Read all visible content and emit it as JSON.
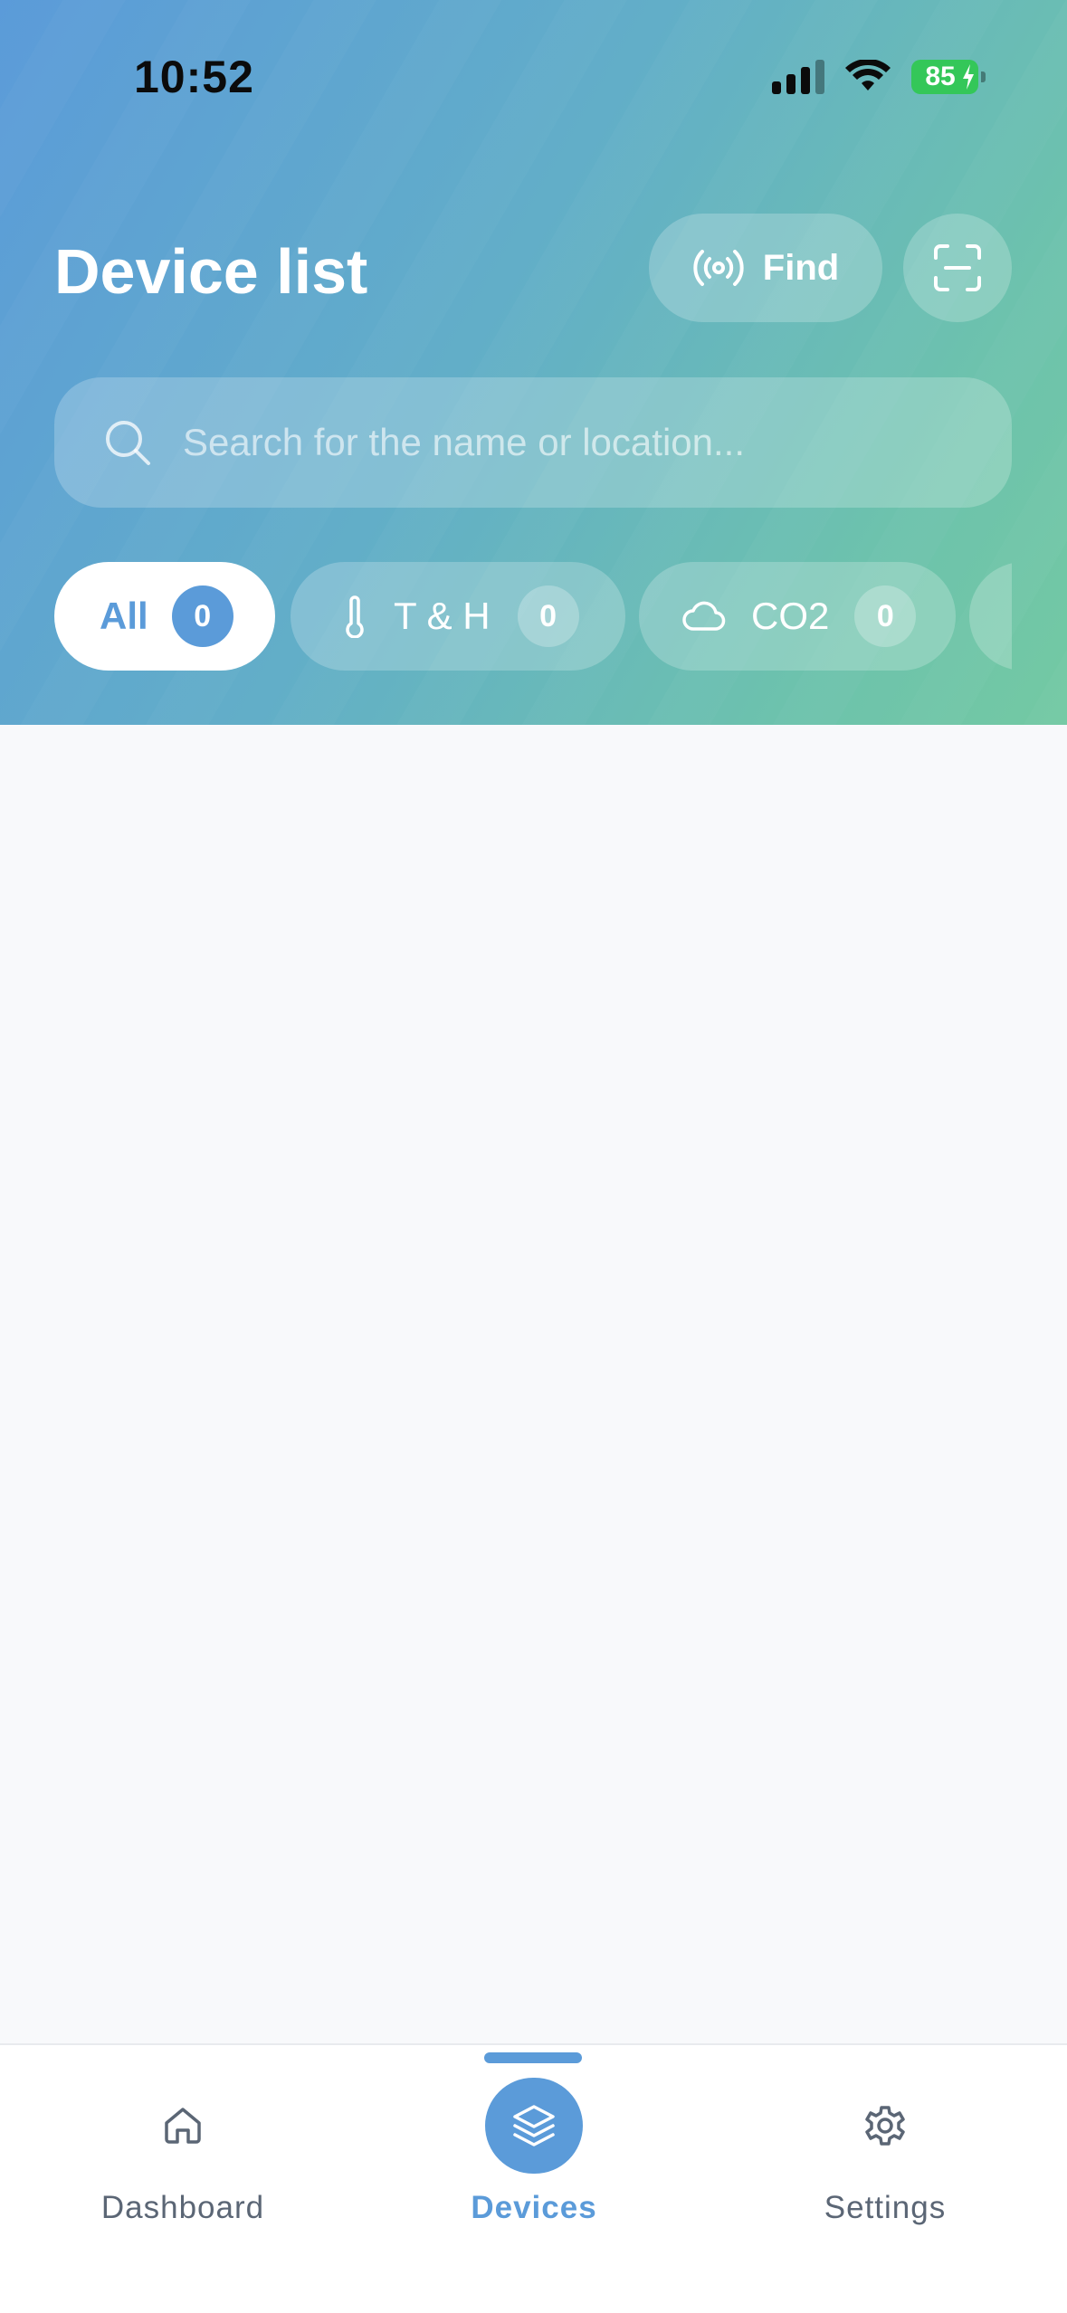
{
  "status_bar": {
    "time": "10:52",
    "battery": "85"
  },
  "header": {
    "title": "Device list",
    "find_label": "Find"
  },
  "search": {
    "placeholder": "Search for the name or location..."
  },
  "filters": [
    {
      "label": "All",
      "count": "0",
      "icon": "none",
      "active": true
    },
    {
      "label": "T & H",
      "count": "0",
      "icon": "thermometer-icon",
      "active": false
    },
    {
      "label": "CO2",
      "count": "0",
      "icon": "cloud-icon",
      "active": false
    }
  ],
  "tabbar": {
    "items": [
      {
        "label": "Dashboard",
        "icon": "home-icon",
        "active": false
      },
      {
        "label": "Devices",
        "icon": "layers-icon",
        "active": true
      },
      {
        "label": "Settings",
        "icon": "gear-icon",
        "active": false
      }
    ]
  },
  "colors": {
    "accent": "#5b9bd9",
    "header_gradient_start": "#5b9bd9",
    "header_gradient_end": "#73c9a3",
    "battery": "#34c759"
  }
}
